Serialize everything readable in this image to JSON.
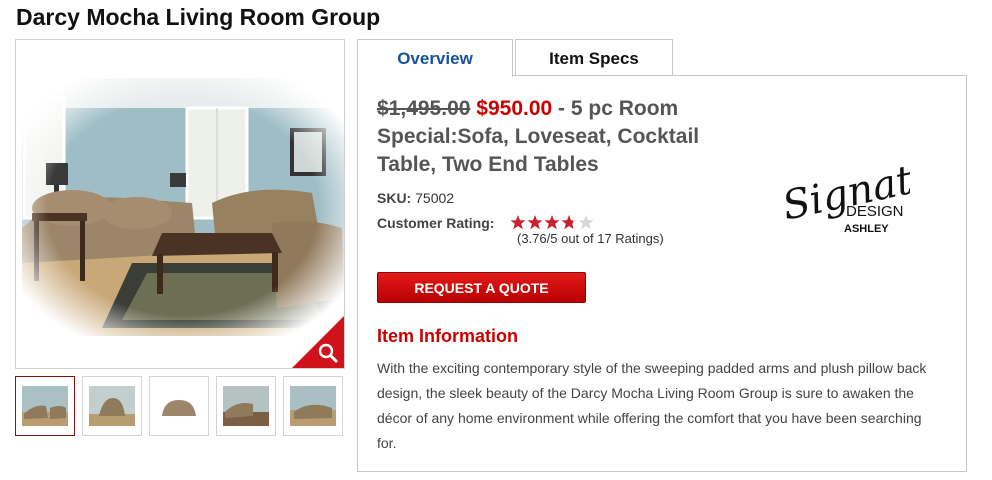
{
  "page": {
    "title": "Darcy Mocha Living Room Group"
  },
  "gallery": {
    "thumbnails": [
      "Room group view",
      "Sofa view",
      "Loveseat view",
      "Set view",
      "Detail view"
    ],
    "active_index": 0,
    "zoom_icon": "magnifier-icon"
  },
  "tabs": [
    {
      "label": "Overview",
      "active": true
    },
    {
      "label": "Item Specs",
      "active": false
    }
  ],
  "product": {
    "old_price": "$1,495.00",
    "new_price": "$950.00",
    "description_line": " - 5 pc Room Special:Sofa, Loveseat, Cocktail Table, Two End Tables",
    "sku_label": "SKU:",
    "sku_value": "75002",
    "rating_label": "Customer Rating:",
    "rating_value": 3.76,
    "rating_max": 5,
    "rating_text": "(3.76/5 out of 17 Ratings)",
    "quote_button": "REQUEST A QUOTE"
  },
  "brand": {
    "logo_line1": "Signature",
    "logo_line2": "DESIGN",
    "logo_line3": "ASHLEY"
  },
  "item_info": {
    "heading": "Item Information",
    "body": "With the exciting contemporary style of the sweeping padded arms and plush pillow back design, the sleek beauty of the Darcy Mocha Living Room Group  is sure to awaken the décor of any home environment while offering the comfort that you have been searching for."
  },
  "colors": {
    "accent_red": "#cc0000",
    "tab_blue": "#17529b",
    "star_red": "#c8232c"
  }
}
